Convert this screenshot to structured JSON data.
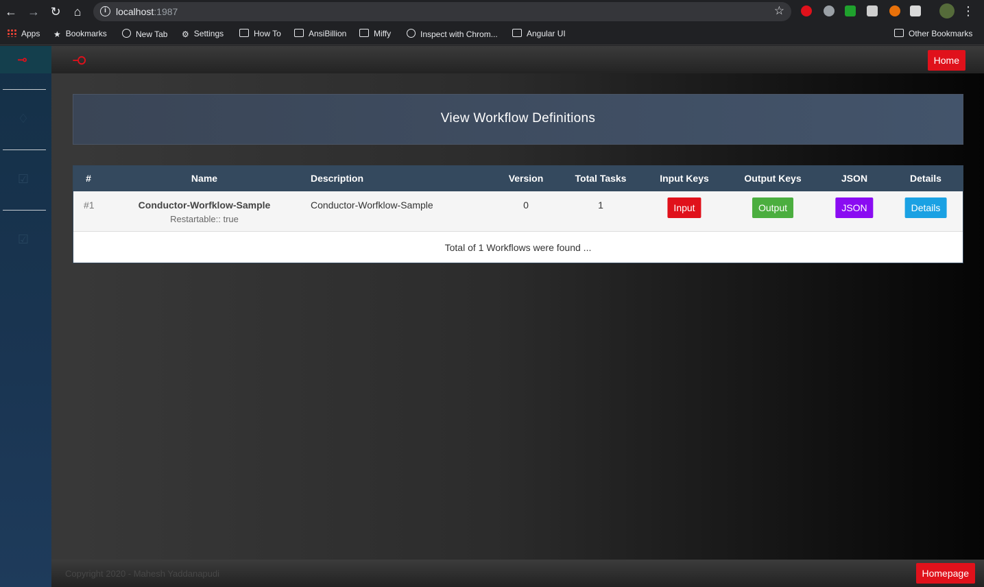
{
  "browser": {
    "url_host": "localhost",
    "url_port": ":1987",
    "bookmarks": [
      "Apps",
      "Bookmarks",
      "New Tab",
      "Settings",
      "How To",
      "AnsiBillion",
      "Miffy",
      "Inspect with Chrom...",
      "Angular UI"
    ],
    "other_bookmarks": "Other Bookmarks",
    "extension_colors": [
      "#e0111b",
      "#9aa0a6",
      "#1fa12d",
      "#cfcfcf",
      "#e8710a",
      "#d9d9d9"
    ]
  },
  "app": {
    "home_label": "Home",
    "page_title": "View Workflow Definitions",
    "accent_color": "#e0111b",
    "table": {
      "headers": [
        "#",
        "Name",
        "Description",
        "Version",
        "Total Tasks",
        "Input Keys",
        "Output Keys",
        "JSON",
        "Details"
      ],
      "rows": [
        {
          "index": "#1",
          "name": "Conductor-Worfklow-Sample",
          "restartable": "Restartable:: true",
          "description": "Conductor-Worfklow-Sample",
          "version": "0",
          "total_tasks": "1",
          "input_label": "Input",
          "output_label": "Output",
          "json_label": "JSON",
          "details_label": "Details"
        }
      ],
      "summary": "Total of 1 Workflows were found ..."
    },
    "button_colors": {
      "input": "#e0111b",
      "output": "#4bae3f",
      "json": "#8a0cf2",
      "details": "#1aa1e3"
    },
    "copyright": "Copyright 2020 - Mahesh Yaddanapudi",
    "homepage_label": "Homepage"
  }
}
